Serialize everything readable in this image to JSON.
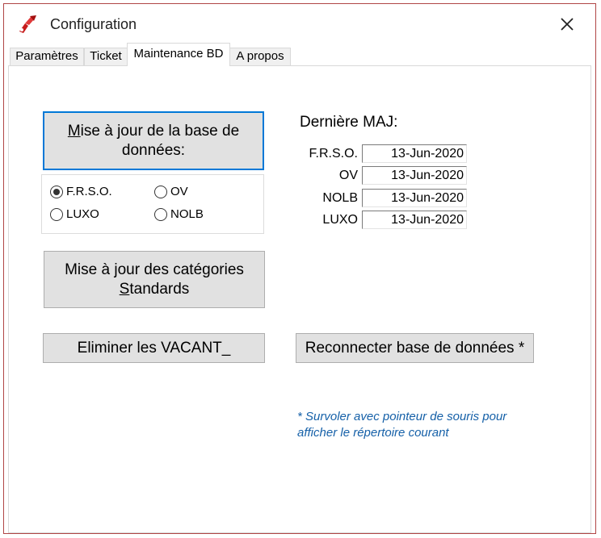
{
  "window": {
    "title": "Configuration",
    "app_icon": "red-tool-icon",
    "close_icon": "close-x-icon"
  },
  "tabs": [
    {
      "label": "Paramètres"
    },
    {
      "label": "Ticket"
    },
    {
      "label": "Maintenance BD"
    },
    {
      "label": "A propos"
    }
  ],
  "active_tab": "Maintenance BD",
  "maintenance": {
    "update_db_button": {
      "underline": "M",
      "text_line1_rest": "ise à jour de la base de",
      "text_line2": "données:"
    },
    "databases": [
      {
        "label": "F.R.S.O.",
        "checked": true
      },
      {
        "label": "OV",
        "checked": false
      },
      {
        "label": "LUXO",
        "checked": false
      },
      {
        "label": "NOLB",
        "checked": false
      }
    ],
    "update_categories_button": {
      "line1": "Mise à jour des catégories",
      "line2_underline": "S",
      "line2_rest": "tandards"
    },
    "remove_vacant_button": "Eliminer les VACANT_",
    "reconnect_button": "Reconnecter base de données *",
    "last_update": {
      "heading": "Dernière MAJ:",
      "rows": [
        {
          "label": "F.R.S.O.",
          "value": "13-Jun-2020"
        },
        {
          "label": "OV",
          "value": "13-Jun-2020"
        },
        {
          "label": "NOLB",
          "value": "13-Jun-2020"
        },
        {
          "label": "LUXO",
          "value": "13-Jun-2020"
        }
      ]
    },
    "note_line1": "* Survoler avec pointeur de souris pour",
    "note_line2": "afficher le  répertoire courant"
  },
  "colors": {
    "window_border": "#b04545",
    "focus_border": "#0078d7",
    "note_text": "#1560a8",
    "button_face": "#e1e1e1"
  }
}
